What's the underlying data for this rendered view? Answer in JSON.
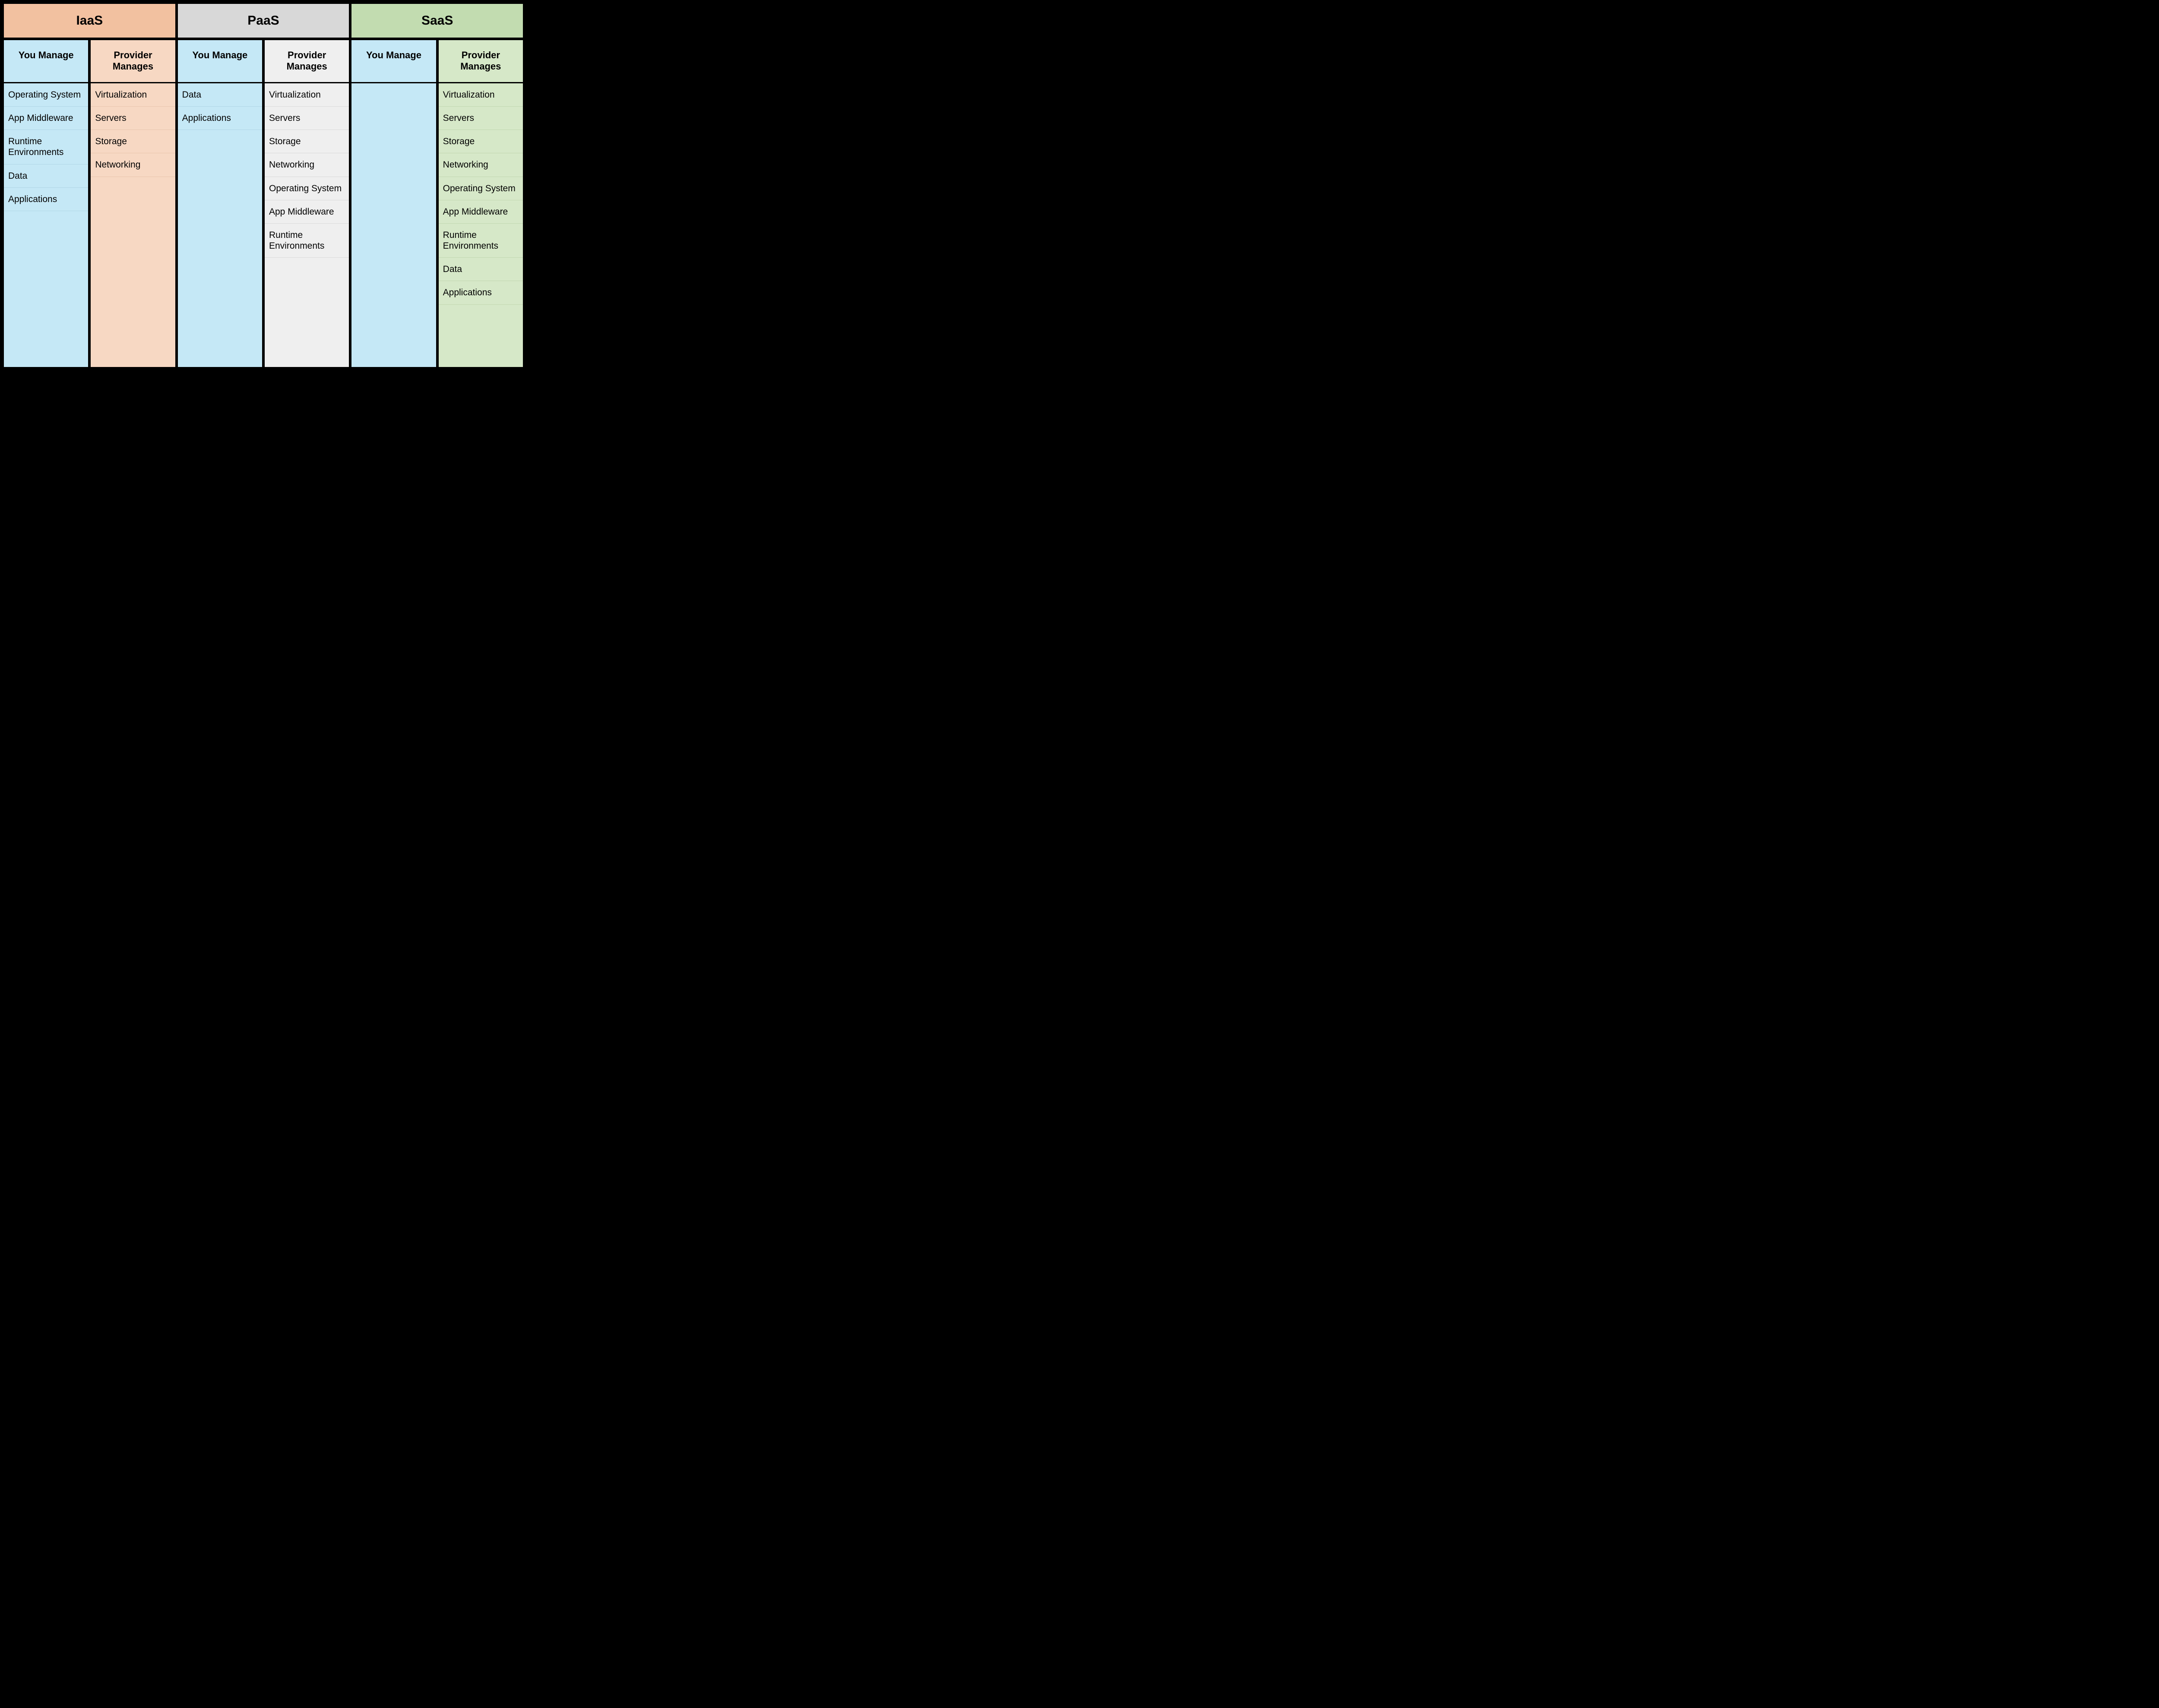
{
  "models": [
    {
      "name": "IaaS",
      "providerClass": "iaasP",
      "subYou": "You Manage",
      "subProvider": "Provider Manages",
      "youManage": [
        "Operating System",
        "App Middleware",
        "Runtime Environments",
        "Data",
        "Applications"
      ],
      "providerManages": [
        "Virtualization",
        "Servers",
        "Storage",
        "Networking"
      ]
    },
    {
      "name": "PaaS",
      "providerClass": "paasP",
      "subYou": "You Manage",
      "subProvider": "Provider Manages",
      "youManage": [
        "Data",
        "Applications"
      ],
      "providerManages": [
        "Virtualization",
        "Servers",
        "Storage",
        "Networking",
        "Operating System",
        "App Middleware",
        "Runtime Environments"
      ]
    },
    {
      "name": "SaaS",
      "providerClass": "saasP",
      "subYou": "You Manage",
      "subProvider": "Provider Manages",
      "youManage": [],
      "providerManages": [
        "Virtualization",
        "Servers",
        "Storage",
        "Networking",
        "Operating System",
        "App Middleware",
        "Runtime Environments",
        "Data",
        "Applications"
      ]
    }
  ]
}
